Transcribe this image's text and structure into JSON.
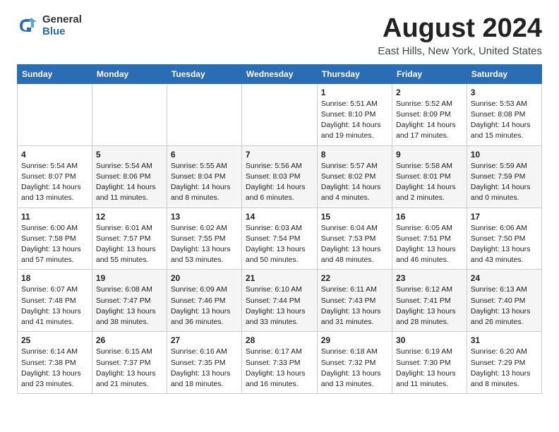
{
  "logo": {
    "general": "General",
    "blue": "Blue"
  },
  "title": "August 2024",
  "subtitle": "East Hills, New York, United States",
  "days_of_week": [
    "Sunday",
    "Monday",
    "Tuesday",
    "Wednesday",
    "Thursday",
    "Friday",
    "Saturday"
  ],
  "weeks": [
    [
      {
        "day": "",
        "info": ""
      },
      {
        "day": "",
        "info": ""
      },
      {
        "day": "",
        "info": ""
      },
      {
        "day": "",
        "info": ""
      },
      {
        "day": "1",
        "info": "Sunrise: 5:51 AM\nSunset: 8:10 PM\nDaylight: 14 hours\nand 19 minutes."
      },
      {
        "day": "2",
        "info": "Sunrise: 5:52 AM\nSunset: 8:09 PM\nDaylight: 14 hours\nand 17 minutes."
      },
      {
        "day": "3",
        "info": "Sunrise: 5:53 AM\nSunset: 8:08 PM\nDaylight: 14 hours\nand 15 minutes."
      }
    ],
    [
      {
        "day": "4",
        "info": "Sunrise: 5:54 AM\nSunset: 8:07 PM\nDaylight: 14 hours\nand 13 minutes."
      },
      {
        "day": "5",
        "info": "Sunrise: 5:54 AM\nSunset: 8:06 PM\nDaylight: 14 hours\nand 11 minutes."
      },
      {
        "day": "6",
        "info": "Sunrise: 5:55 AM\nSunset: 8:04 PM\nDaylight: 14 hours\nand 8 minutes."
      },
      {
        "day": "7",
        "info": "Sunrise: 5:56 AM\nSunset: 8:03 PM\nDaylight: 14 hours\nand 6 minutes."
      },
      {
        "day": "8",
        "info": "Sunrise: 5:57 AM\nSunset: 8:02 PM\nDaylight: 14 hours\nand 4 minutes."
      },
      {
        "day": "9",
        "info": "Sunrise: 5:58 AM\nSunset: 8:01 PM\nDaylight: 14 hours\nand 2 minutes."
      },
      {
        "day": "10",
        "info": "Sunrise: 5:59 AM\nSunset: 7:59 PM\nDaylight: 14 hours\nand 0 minutes."
      }
    ],
    [
      {
        "day": "11",
        "info": "Sunrise: 6:00 AM\nSunset: 7:58 PM\nDaylight: 13 hours\nand 57 minutes."
      },
      {
        "day": "12",
        "info": "Sunrise: 6:01 AM\nSunset: 7:57 PM\nDaylight: 13 hours\nand 55 minutes."
      },
      {
        "day": "13",
        "info": "Sunrise: 6:02 AM\nSunset: 7:55 PM\nDaylight: 13 hours\nand 53 minutes."
      },
      {
        "day": "14",
        "info": "Sunrise: 6:03 AM\nSunset: 7:54 PM\nDaylight: 13 hours\nand 50 minutes."
      },
      {
        "day": "15",
        "info": "Sunrise: 6:04 AM\nSunset: 7:53 PM\nDaylight: 13 hours\nand 48 minutes."
      },
      {
        "day": "16",
        "info": "Sunrise: 6:05 AM\nSunset: 7:51 PM\nDaylight: 13 hours\nand 46 minutes."
      },
      {
        "day": "17",
        "info": "Sunrise: 6:06 AM\nSunset: 7:50 PM\nDaylight: 13 hours\nand 43 minutes."
      }
    ],
    [
      {
        "day": "18",
        "info": "Sunrise: 6:07 AM\nSunset: 7:48 PM\nDaylight: 13 hours\nand 41 minutes."
      },
      {
        "day": "19",
        "info": "Sunrise: 6:08 AM\nSunset: 7:47 PM\nDaylight: 13 hours\nand 38 minutes."
      },
      {
        "day": "20",
        "info": "Sunrise: 6:09 AM\nSunset: 7:46 PM\nDaylight: 13 hours\nand 36 minutes."
      },
      {
        "day": "21",
        "info": "Sunrise: 6:10 AM\nSunset: 7:44 PM\nDaylight: 13 hours\nand 33 minutes."
      },
      {
        "day": "22",
        "info": "Sunrise: 6:11 AM\nSunset: 7:43 PM\nDaylight: 13 hours\nand 31 minutes."
      },
      {
        "day": "23",
        "info": "Sunrise: 6:12 AM\nSunset: 7:41 PM\nDaylight: 13 hours\nand 28 minutes."
      },
      {
        "day": "24",
        "info": "Sunrise: 6:13 AM\nSunset: 7:40 PM\nDaylight: 13 hours\nand 26 minutes."
      }
    ],
    [
      {
        "day": "25",
        "info": "Sunrise: 6:14 AM\nSunset: 7:38 PM\nDaylight: 13 hours\nand 23 minutes."
      },
      {
        "day": "26",
        "info": "Sunrise: 6:15 AM\nSunset: 7:37 PM\nDaylight: 13 hours\nand 21 minutes."
      },
      {
        "day": "27",
        "info": "Sunrise: 6:16 AM\nSunset: 7:35 PM\nDaylight: 13 hours\nand 18 minutes."
      },
      {
        "day": "28",
        "info": "Sunrise: 6:17 AM\nSunset: 7:33 PM\nDaylight: 13 hours\nand 16 minutes."
      },
      {
        "day": "29",
        "info": "Sunrise: 6:18 AM\nSunset: 7:32 PM\nDaylight: 13 hours\nand 13 minutes."
      },
      {
        "day": "30",
        "info": "Sunrise: 6:19 AM\nSunset: 7:30 PM\nDaylight: 13 hours\nand 11 minutes."
      },
      {
        "day": "31",
        "info": "Sunrise: 6:20 AM\nSunset: 7:29 PM\nDaylight: 13 hours\nand 8 minutes."
      }
    ]
  ]
}
